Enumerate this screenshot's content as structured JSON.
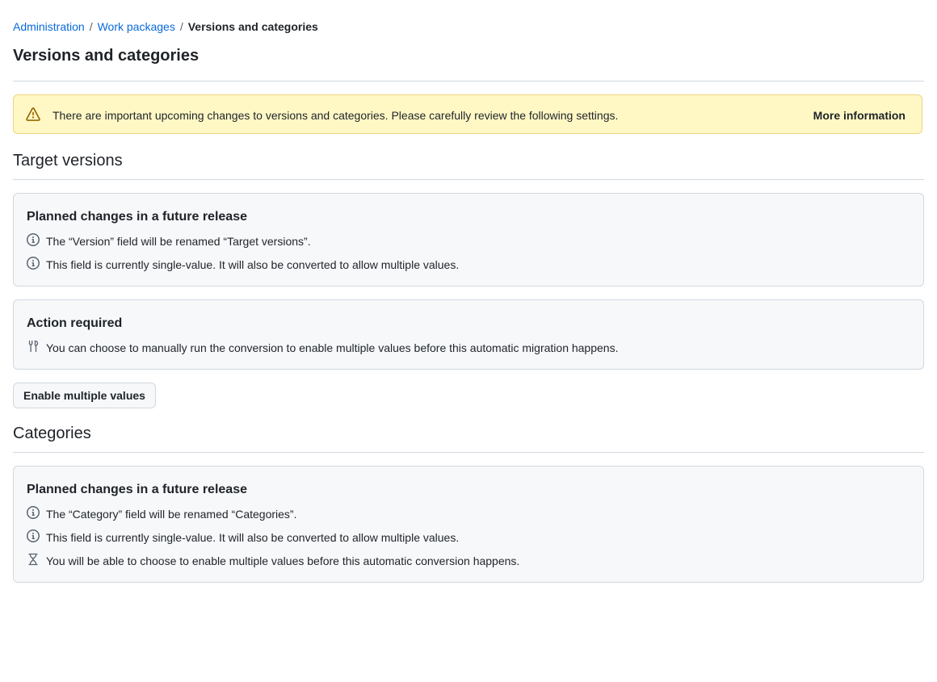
{
  "breadcrumb": {
    "items": [
      "Administration",
      "Work packages"
    ],
    "separator": "/",
    "current": "Versions and categories"
  },
  "page_title": "Versions and categories",
  "flash": {
    "icon": "alert-icon",
    "message": "There are important upcoming changes to versions and categories. Please carefully review the following settings.",
    "action_label": "More information",
    "color": "#fff8c5"
  },
  "target_versions": {
    "heading": "Target versions",
    "planned": {
      "title": "Planned changes in a future release",
      "rows": [
        {
          "icon": "info-icon",
          "text": "The “Version” field will be renamed “Target versions”."
        },
        {
          "icon": "info-icon",
          "text": "This field is currently single-value. It will also be converted to allow multiple values."
        }
      ]
    },
    "action": {
      "title": "Action required",
      "rows": [
        {
          "icon": "tools-icon",
          "text": "You can choose to manually run the conversion to enable multiple values before this automatic migration happens."
        }
      ]
    },
    "button_label": "Enable multiple values"
  },
  "categories": {
    "heading": "Categories",
    "planned": {
      "title": "Planned changes in a future release",
      "rows": [
        {
          "icon": "info-icon",
          "text": "The “Category” field will be renamed “Categories”."
        },
        {
          "icon": "info-icon",
          "text": "This field is currently single-value. It will also be converted to allow multiple values."
        },
        {
          "icon": "hourglass-icon",
          "text": "You will be able to choose to enable multiple values before this automatic conversion happens."
        }
      ]
    }
  }
}
